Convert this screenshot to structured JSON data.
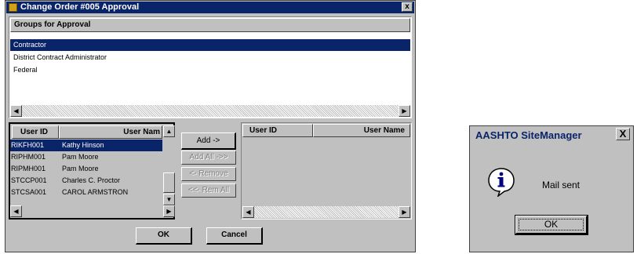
{
  "dialog": {
    "title": "Change Order #005 Approval",
    "close_glyph": "x"
  },
  "groups": {
    "header": "Groups for Approval",
    "items": [
      {
        "label": "Contractor",
        "selected": true
      },
      {
        "label": "District Contract Administrator",
        "selected": false
      },
      {
        "label": "Federal",
        "selected": false
      }
    ]
  },
  "available_users": {
    "col_id": "User ID",
    "col_name": "User Nam",
    "rows": [
      {
        "id": "RIKFH001",
        "name": "Kathy Hinson",
        "selected": true
      },
      {
        "id": "RIPHM001",
        "name": "Pam Moore",
        "selected": false
      },
      {
        "id": "RIPMH001",
        "name": "Pam Moore",
        "selected": false
      },
      {
        "id": "STCCP001",
        "name": "Charles C. Proctor",
        "selected": false
      },
      {
        "id": "STCSA001",
        "name": "CAROL ARMSTRON",
        "selected": false
      }
    ]
  },
  "selected_users": {
    "col_id": "User ID",
    "col_name": "User Name"
  },
  "transfer_buttons": {
    "add": "Add ->",
    "add_all": "Add All ->>",
    "remove": "<- Remove",
    "remove_all": "<<- Rem All"
  },
  "footer": {
    "ok": "OK",
    "cancel": "Cancel"
  },
  "message_box": {
    "title": "AASHTO SiteManager",
    "close_glyph": "X",
    "icon": "info-icon",
    "text": "Mail sent",
    "ok": "OK"
  },
  "colors": {
    "selection": "#0a246a",
    "face": "#c0c0c0"
  }
}
